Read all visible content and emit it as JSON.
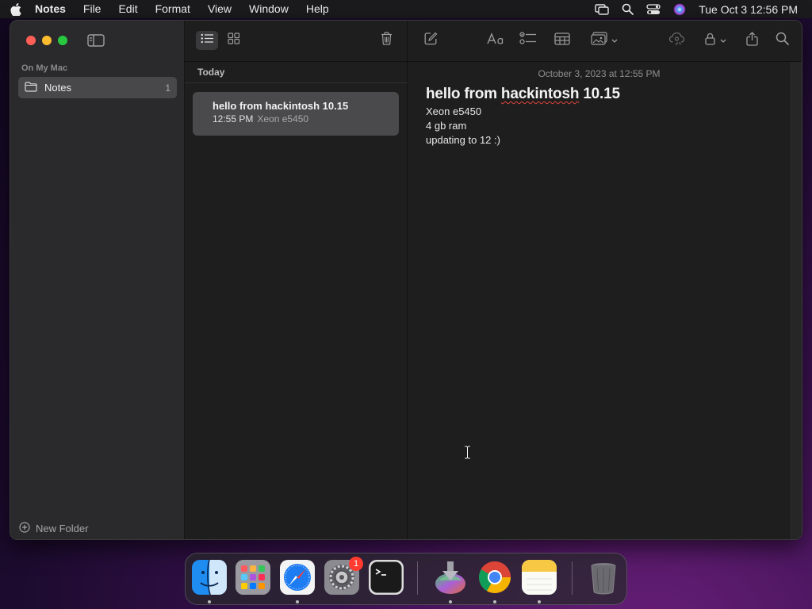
{
  "menubar": {
    "app_name": "Notes",
    "items": [
      "File",
      "Edit",
      "Format",
      "View",
      "Window",
      "Help"
    ],
    "clock": "Tue Oct 3  12:56 PM"
  },
  "sidebar": {
    "section_label": "On My Mac",
    "folder": {
      "label": "Notes",
      "count": "1"
    },
    "new_folder_label": "New Folder"
  },
  "list": {
    "section_label": "Today",
    "note": {
      "title": "hello from hackintosh 10.15",
      "time": "12:55 PM",
      "preview": "Xeon e5450"
    }
  },
  "editor": {
    "date": "October 3, 2023 at 12:55 PM",
    "title_pre": "hello from ",
    "title_misspelled": "hackintosh",
    "title_post": " 10.15",
    "lines": [
      "Xeon e5450",
      "4 gb ram",
      "updating to 12 :)"
    ]
  },
  "dock": {
    "badge_count": "1",
    "items": [
      "finder-icon",
      "launchpad-icon",
      "safari-icon",
      "system-preferences-icon",
      "terminal-icon",
      "installer-icon",
      "chrome-icon",
      "notes-icon",
      "trash-icon"
    ]
  },
  "colors": {
    "close": "#ff5f57",
    "minimize": "#febc2e",
    "zoom": "#28c840",
    "selection": "#4a4a4c",
    "badge": "#ff3b30"
  }
}
